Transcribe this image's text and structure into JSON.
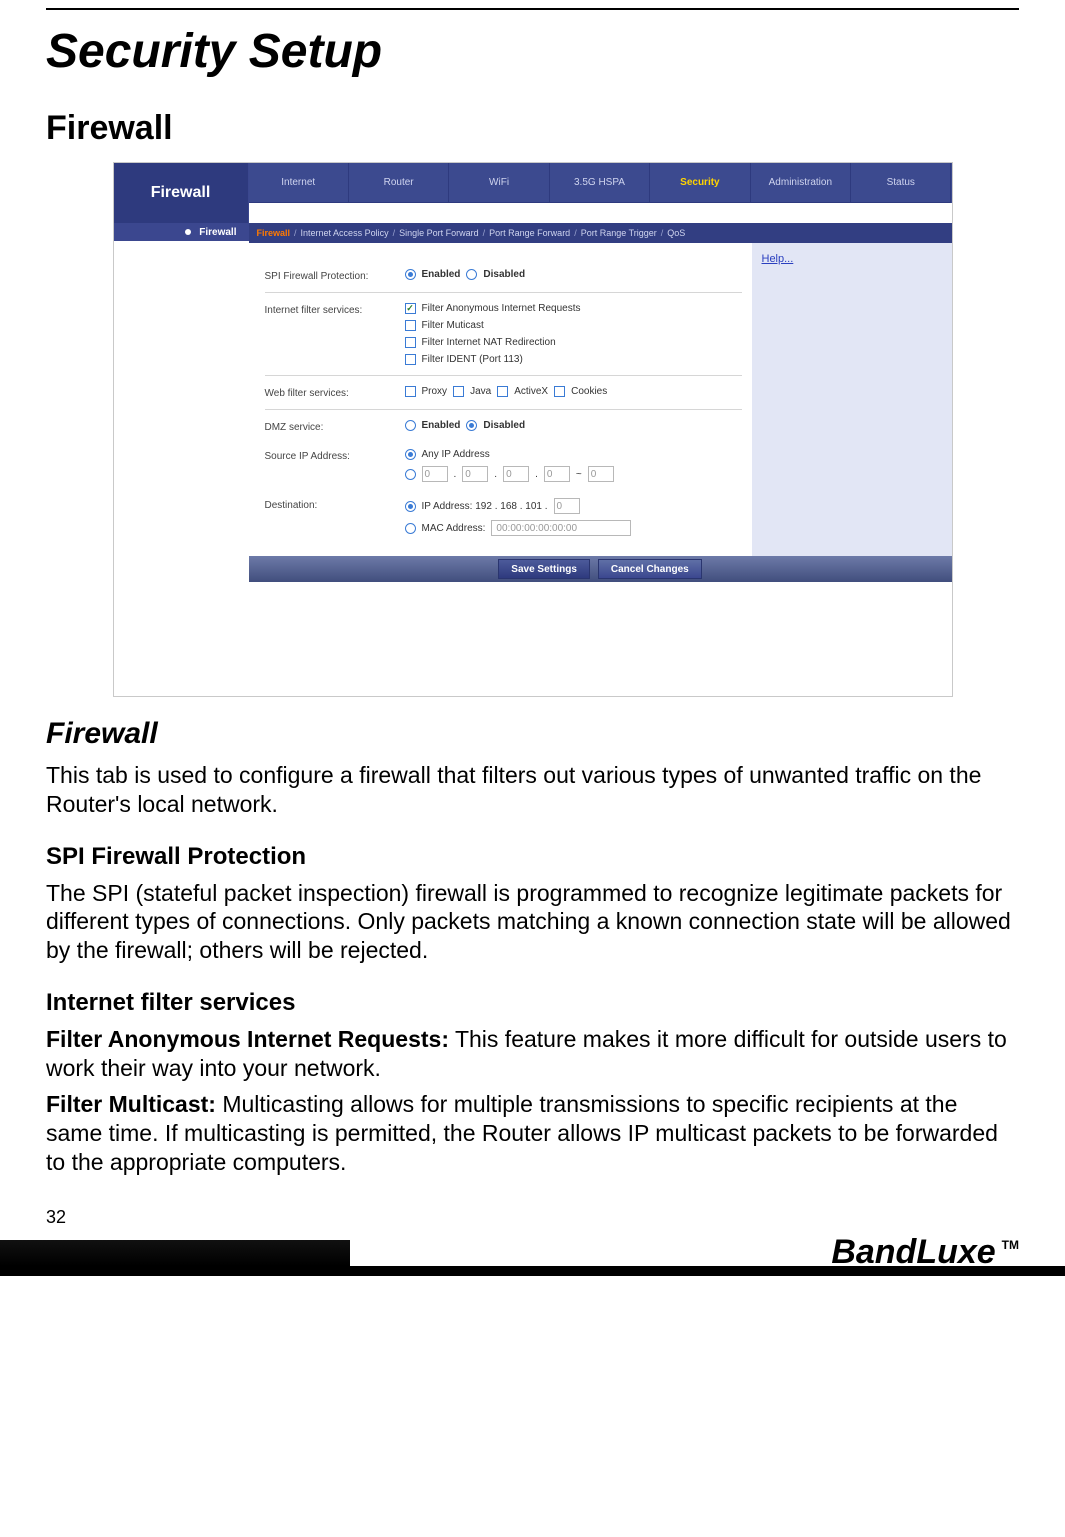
{
  "doc": {
    "title": "Security Setup",
    "section": "Firewall",
    "sub_heading": "Firewall",
    "intro": "This tab is used to configure a firewall that filters out various types of unwanted traffic on the Router's local network.",
    "h_spi": "SPI Firewall Protection",
    "p_spi": "The SPI (stateful packet inspection) firewall is programmed to recognize legitimate packets for different types of connections. Only packets matching a known connection state will be allowed by the firewall; others will be rejected.",
    "h_ifs": "Internet filter services",
    "p_fair_label": "Filter Anonymous Internet Requests:",
    "p_fair_text": " This feature makes it more difficult for outside users to work their way into your network.",
    "p_fmc_label": "Filter Multicast:",
    "p_fmc_text": " Multicasting allows for multiple transmissions to specific recipients at the same time. If multicasting is permitted, the Router allows IP multicast packets to be forwarded to the appropriate computers.",
    "page_number": "32",
    "brand": "BandLuxe",
    "tm": "TM"
  },
  "ui": {
    "sidebar": {
      "title": "Firewall",
      "sub": "Firewall"
    },
    "tabs": [
      "Internet",
      "Router",
      "WiFi",
      "3.5G HSPA",
      "Security",
      "Administration",
      "Status"
    ],
    "active_tab_index": 4,
    "subtabs": [
      "Firewall",
      "Internet Access Policy",
      "Single Port Forward",
      "Port Range Forward",
      "Port Range Trigger",
      "QoS"
    ],
    "active_subtab_index": 0,
    "help": "Help...",
    "labels": {
      "spi": "SPI Firewall Protection:",
      "ifs": "Internet filter services:",
      "wfs": "Web filter services:",
      "dmz": "DMZ service:",
      "src": "Source IP Address:",
      "dst": "Destination:"
    },
    "opts": {
      "enabled": "Enabled",
      "disabled": "Disabled",
      "fair": "Filter Anonymous Internet Requests",
      "fmc": "Filter Muticast",
      "fnat": "Filter Internet NAT Redirection",
      "fident": "Filter IDENT (Port 113)",
      "proxy": "Proxy",
      "java": "Java",
      "activex": "ActiveX",
      "cookies": "Cookies",
      "anyip": "Any IP Address",
      "ipaddr_prefix": "IP Address: 192 . 168 . 101 .",
      "macaddr_label": "MAC Address:",
      "mac_placeholder": "00:00:00:00:00:00",
      "ip_placeholder": "0",
      "dash": "~"
    },
    "buttons": {
      "save": "Save Settings",
      "cancel": "Cancel Changes"
    }
  }
}
